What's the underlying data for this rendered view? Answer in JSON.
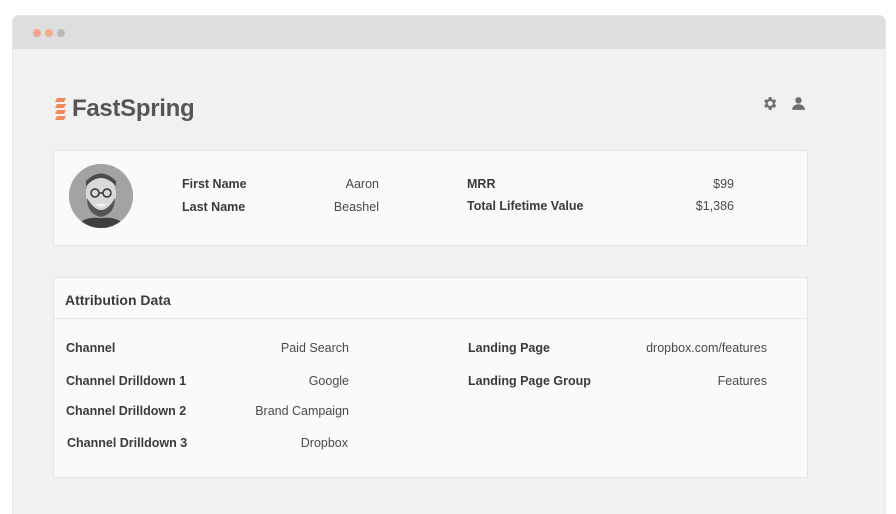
{
  "brand": {
    "name_fast": "Fast",
    "name_spring": "Spring",
    "accent_color": "#f08a5d"
  },
  "toolbar": {
    "settings_icon": "gear-icon",
    "user_icon": "user-icon"
  },
  "profile": {
    "first_name_label": "First Name",
    "first_name_value": "Aaron",
    "last_name_label": "Last Name",
    "last_name_value": "Beashel",
    "mrr_label": "MRR",
    "mrr_value": "$99",
    "ltv_label": "Total Lifetime Value",
    "ltv_value": "$1,386"
  },
  "attribution": {
    "title": "Attribution Data",
    "rows": [
      {
        "label": "Channel",
        "value": "Paid Search"
      },
      {
        "label": "Channel Drilldown 1",
        "value": "Google"
      },
      {
        "label": "Channel Drilldown 2",
        "value": "Brand Campaign"
      },
      {
        "label": "Channel Drilldown 3",
        "value": "Dropbox"
      }
    ],
    "right_rows": [
      {
        "label": "Landing Page",
        "value": "dropbox.com/features"
      },
      {
        "label": "Landing Page Group",
        "value": "Features"
      }
    ]
  }
}
